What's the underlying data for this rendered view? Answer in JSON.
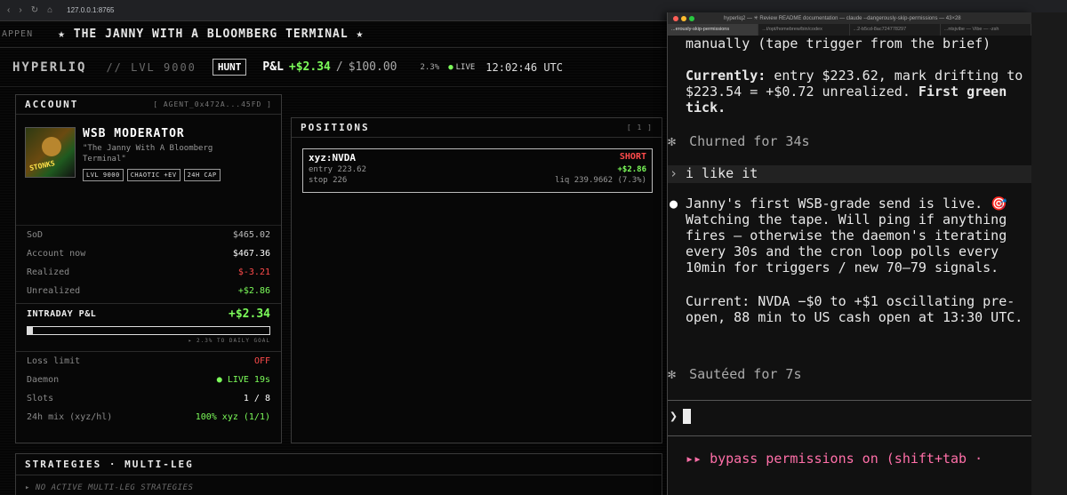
{
  "browser": {
    "url": "127.0.0.1:8765"
  },
  "ticker": {
    "pre": "APPEN",
    "text": "★ THE JANNY WITH A BLOOMBERG TERMINAL ★"
  },
  "header": {
    "brand": "HYPERLIQ",
    "lvl": "// LVL 9000",
    "mode": "HUNT",
    "pnl_label": "P&L",
    "pnl_value": "+$2.34",
    "slash": "/",
    "goal": "$100.00",
    "pct": "2.3%",
    "live": "LIVE",
    "clock": "12:02:46 UTC"
  },
  "account": {
    "title": "ACCOUNT",
    "agent": "[ AGENT_0x472A...45FD ]",
    "role": "WSB MODERATOR",
    "quote": "\"The Janny With A Bloomberg Terminal\"",
    "avatar_text": "STONKS",
    "tags": [
      "LVL 9000",
      "CHAOTIC +EV",
      "24H CAP"
    ],
    "rows": [
      {
        "label": "SoD",
        "value": "$465.02"
      },
      {
        "label": "Account now",
        "value": "$467.36"
      },
      {
        "label": "Realized",
        "value": "$-3.21"
      },
      {
        "label": "Unrealized",
        "value": "+$2.86"
      }
    ],
    "intraday_label": "INTRADAY P&L",
    "intraday_value": "+$2.34",
    "progress_fraction": 0.023,
    "goal_note": "▸ 2.3% TO DAILY GOAL",
    "rows2": [
      {
        "label": "Loss limit",
        "value": "OFF"
      },
      {
        "label": "Daemon",
        "value": "● LIVE 19s"
      },
      {
        "label": "Slots",
        "value": "1 / 8"
      },
      {
        "label": "24h mix (xyz/hl)",
        "value": "100% xyz (1/1)"
      }
    ]
  },
  "positions": {
    "title": "POSITIONS",
    "count": "[ 1 ]",
    "items": [
      {
        "symbol": "xyz:NVDA",
        "side": "SHORT",
        "entry": "entry 223.62",
        "pnl": "+$2.86",
        "stop": "stop 226",
        "liq": "liq 239.9662 (7.3%)"
      }
    ]
  },
  "strategies": {
    "title": "STRATEGIES · MULTI-LEG",
    "empty": "▸ NO ACTIVE MULTI-LEG STRATEGIES"
  },
  "terminal": {
    "title": "hyperliq2 — ✳ Review README documentation — claude --dangerously-skip-permissions — 43×28",
    "tabs": [
      "...erously-skip-permissions",
      "...t/opt/homebrew/bin/codex",
      "...2-b5cd-8ac724778297",
      "...ntsjvibe — Vibe — -zsh"
    ],
    "line1": "manually (tape trigger from the brief)",
    "currently_label": "Currently:",
    "currently_text": "entry $223.62, mark drifting to $223.54 = +$0.72 unrealized.",
    "first_green": "First green tick.",
    "churned": "Churned for 34s",
    "user_prompt": "i like it",
    "msg": "Janny's first WSB-grade send is live. 🎯 Watching the tape. Will ping if anything fires — otherwise the daemon's iterating every 30s and the cron loop polls every 10min for triggers / new 70–79 signals.",
    "current": "Current: NVDA −$0 to +$1 oscillating pre-open, 88 min to US cash open at 13:30 UTC.",
    "sauteed": "Sautéed for 7s",
    "input_prompt": "❯",
    "bypass": "▸▸ bypass permissions on (shift+tab ·"
  }
}
